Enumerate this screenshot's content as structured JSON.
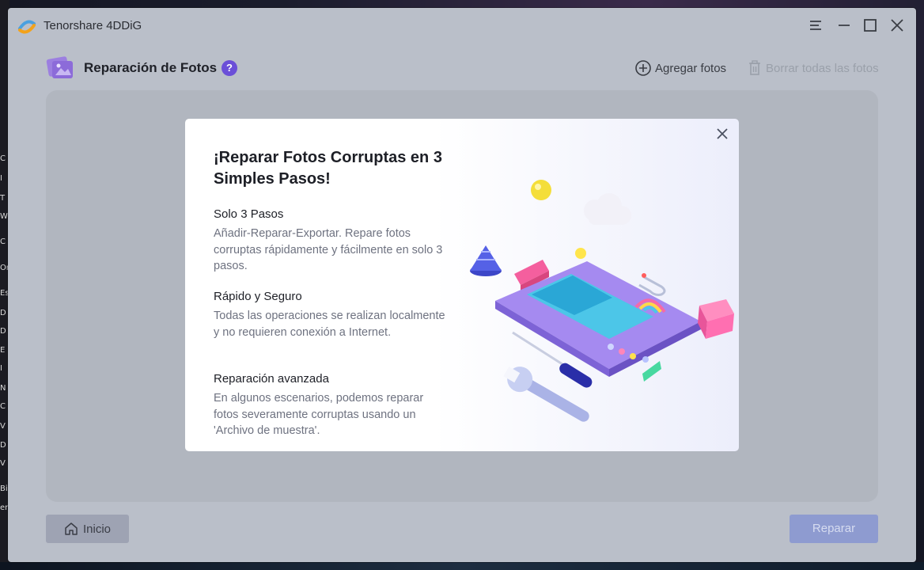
{
  "window": {
    "app_title": "Tenorshare 4DDiG"
  },
  "header": {
    "title": "Reparación de Fotos",
    "help_label": "?",
    "add_label": "Agregar fotos",
    "delete_all_label": "Borrar todas las fotos"
  },
  "modal": {
    "title": "¡Reparar Fotos Corruptas en 3 Simples Pasos!",
    "steps": [
      {
        "title": "Solo 3 Pasos",
        "desc": "Añadir-Reparar-Exportar. Repare fotos corruptas rápidamente y fácilmente en solo 3 pasos."
      },
      {
        "title": "Rápido y Seguro",
        "desc": "Todas las operaciones se realizan localmente y no requieren conexión a Internet."
      },
      {
        "title": "Reparación avanzada",
        "desc": "En algunos escenarios, podemos reparar fotos severamente corruptas usando un 'Archivo de muestra'."
      }
    ]
  },
  "footer": {
    "home_label": "Inicio",
    "repair_label": "Reparar"
  },
  "desktop_fragments": [
    "C",
    "I",
    "T",
    "W",
    "C",
    "Or",
    "Es",
    "D",
    "D",
    "E",
    "I",
    "N",
    "C",
    "V",
    "D",
    "V",
    "Bi",
    "en"
  ],
  "colors": {
    "accent": "#6b4fd8",
    "repair_button": "#8e9bd0",
    "overlay_bg": "#babfc9"
  }
}
